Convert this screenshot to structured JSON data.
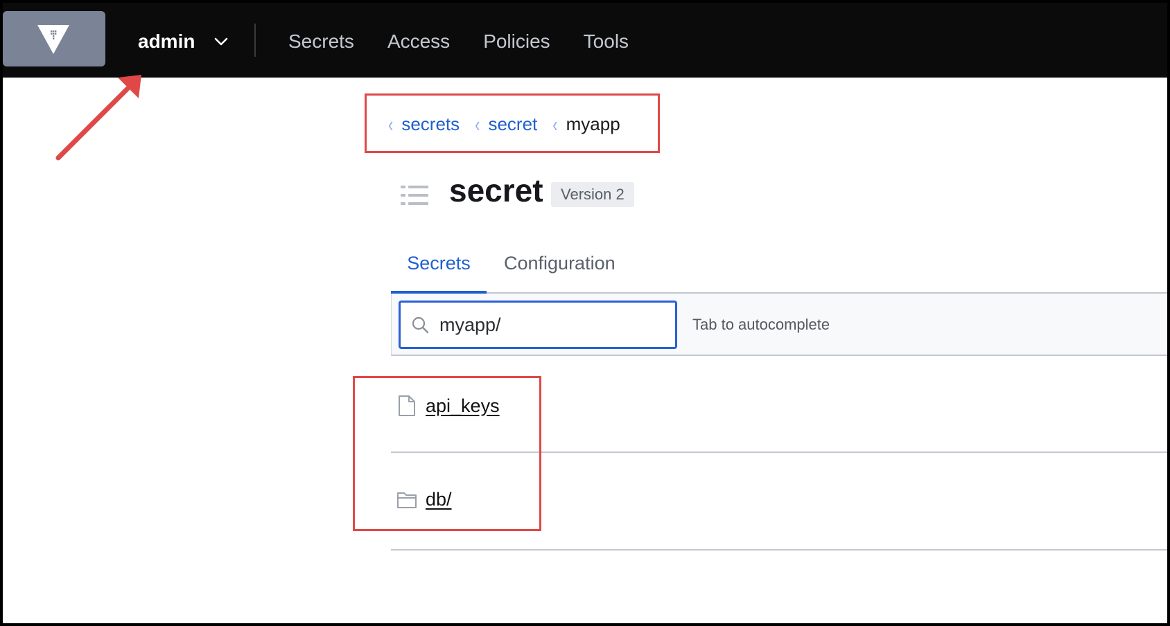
{
  "nav": {
    "namespace": "admin",
    "links": [
      "Secrets",
      "Access",
      "Policies",
      "Tools"
    ]
  },
  "breadcrumb": {
    "items": [
      {
        "label": "secrets",
        "link": true
      },
      {
        "label": "secret",
        "link": true
      },
      {
        "label": "myapp",
        "link": false
      }
    ]
  },
  "header": {
    "title": "secret",
    "version_badge": "Version 2"
  },
  "tabs": [
    {
      "label": "Secrets",
      "active": true
    },
    {
      "label": "Configuration",
      "active": false
    }
  ],
  "filter": {
    "value": "myapp/",
    "hint": "Tab to autocomplete"
  },
  "list": [
    {
      "label": "api_keys",
      "icon": "file-icon"
    },
    {
      "label": "db/",
      "icon": "folder-icon"
    }
  ],
  "colors": {
    "accent": "#1f5fd1",
    "nav_bg": "#0b0b0b",
    "annotation": "#e04848"
  }
}
